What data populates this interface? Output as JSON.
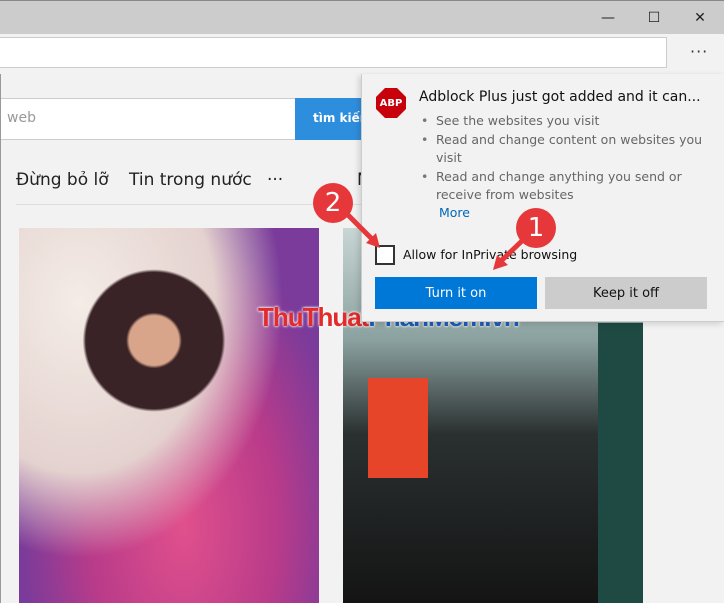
{
  "window": {
    "minimize": "—",
    "maximize": "☐",
    "close": "✕"
  },
  "toolbar": {
    "more": "···"
  },
  "page": {
    "search_placeholder": "web",
    "search_button": "tìm kiếm",
    "nav": [
      "Đừng bỏ lỡ",
      "Tin trong nước",
      "···"
    ],
    "nav_partial": "N"
  },
  "popup": {
    "icon_text": "ABP",
    "title": "Adblock Plus just got added and it can...",
    "permissions": [
      "See the websites you visit",
      "Read and change content on websites you visit",
      "Read and change anything you send or receive from websites"
    ],
    "more_link": "More",
    "checkbox_label": "Allow for InPrivate browsing",
    "checkbox_checked": false,
    "turn_on": "Turn it on",
    "keep_off": "Keep it off"
  },
  "annotations": {
    "badge1": "1",
    "badge2": "2"
  },
  "watermark": {
    "part1": "ThuThuat",
    "part2": "PhanMem",
    "part3": ".vn"
  }
}
